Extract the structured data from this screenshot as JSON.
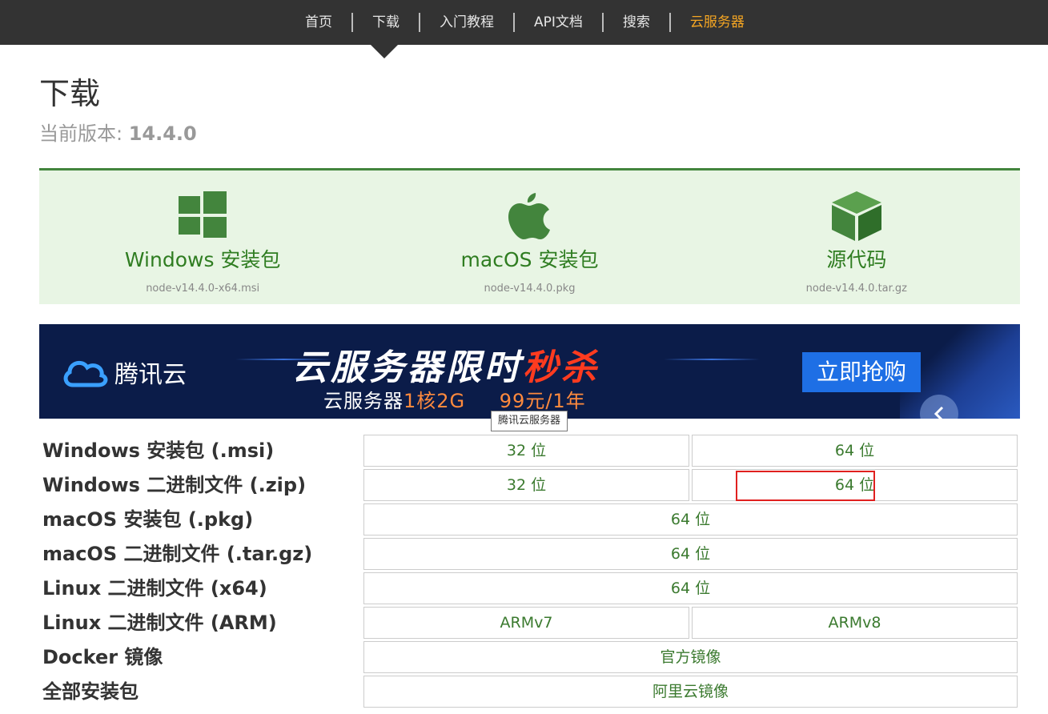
{
  "nav": {
    "items": [
      "首页",
      "下载",
      "入门教程",
      "API文档",
      "搜索",
      "云服务器"
    ]
  },
  "page": {
    "title": "下载",
    "version_label": "当前版本: ",
    "version": "14.4.0"
  },
  "downloads": [
    {
      "icon": "windows-icon",
      "label": "Windows 安装包",
      "file": "node-v14.4.0-x64.msi"
    },
    {
      "icon": "apple-icon",
      "label": "macOS 安装包",
      "file": "node-v14.4.0.pkg"
    },
    {
      "icon": "package-icon",
      "label": "源代码",
      "file": "node-v14.4.0.tar.gz"
    }
  ],
  "banner": {
    "brand": "腾讯云",
    "headline_main": "云服务器限时",
    "headline_hot": "秒杀",
    "sub_pre": "云服务器",
    "sub_hl": "1核2G",
    "sub_price": "99元/1年",
    "button": "立即抢购",
    "tooltip": "腾讯云服务器"
  },
  "table": {
    "rows": [
      {
        "label": "Windows 安装包 (.msi)",
        "cells": [
          "32 位",
          "64 位"
        ]
      },
      {
        "label": "Windows 二进制文件 (.zip)",
        "cells": [
          "32 位",
          "64 位"
        ]
      },
      {
        "label": "macOS 安装包 (.pkg)",
        "cells": [
          "64 位"
        ]
      },
      {
        "label": "macOS 二进制文件 (.tar.gz)",
        "cells": [
          "64 位"
        ]
      },
      {
        "label": "Linux 二进制文件 (x64)",
        "cells": [
          "64 位"
        ]
      },
      {
        "label": "Linux 二进制文件 (ARM)",
        "cells": [
          "ARMv7",
          "ARMv8"
        ]
      },
      {
        "label": "Docker 镜像",
        "cells": [
          "官方镜像"
        ]
      },
      {
        "label": "全部安装包",
        "cells": [
          "阿里云镜像"
        ]
      }
    ]
  },
  "colors": {
    "nav_active": "#f5a623",
    "brand_green": "#43853d",
    "highlight_red": "#e0201f"
  }
}
